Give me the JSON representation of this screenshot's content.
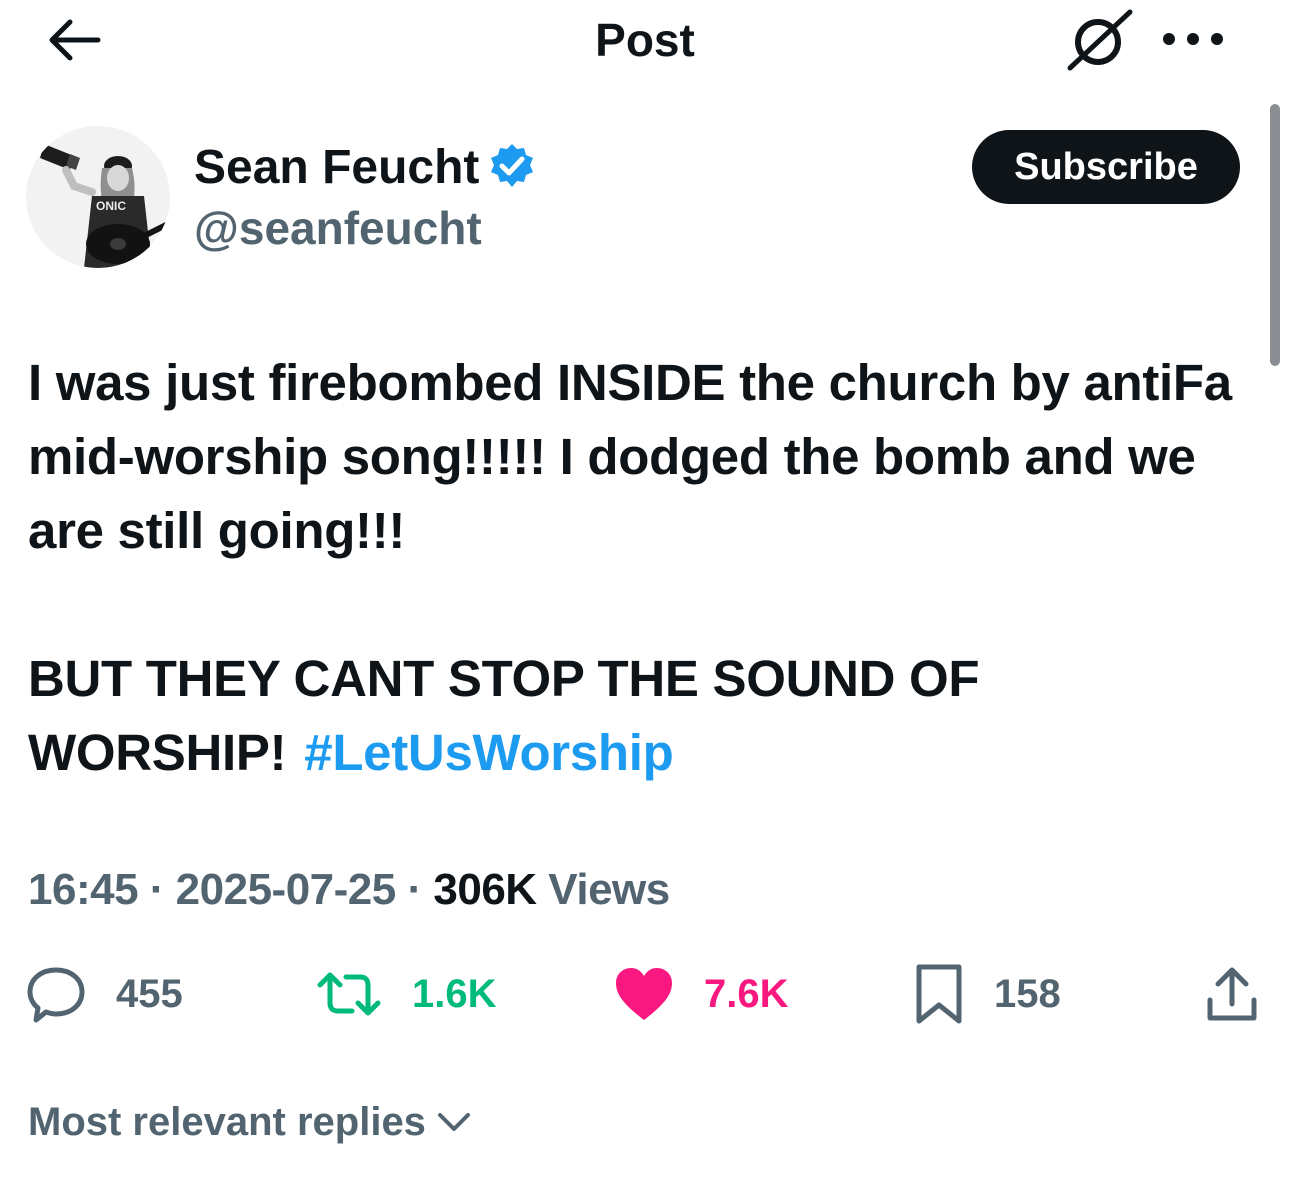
{
  "header": {
    "title": "Post",
    "back_icon": "arrow-left-icon",
    "grok_icon": "grok-icon",
    "more_icon": "more-horizontal-icon"
  },
  "author": {
    "name": "Sean Feucht",
    "handle": "@seanfeucht",
    "verified": true,
    "subscribe_label": "Subscribe"
  },
  "post": {
    "paragraph1": "I was just firebombed INSIDE the church by antiFa mid-worship song!!!!! I dodged the bomb and we are still going!!!",
    "paragraph2": "BUT THEY CANT STOP THE SOUND OF WORSHIP!",
    "hashtag": "#LetUsWorship"
  },
  "meta": {
    "time": "16:45",
    "separator": "·",
    "date": "2025-07-25",
    "views_count": "306K",
    "views_label": "Views"
  },
  "actions": {
    "replies": "455",
    "reposts": "1.6K",
    "likes": "7.6K",
    "bookmarks": "158"
  },
  "replies_sort": {
    "label": "Most relevant replies"
  },
  "colors": {
    "text": "#0f1419",
    "secondary": "#536471",
    "accent": "#1d9bf0",
    "repost": "#00ba7c",
    "like": "#f91880"
  }
}
